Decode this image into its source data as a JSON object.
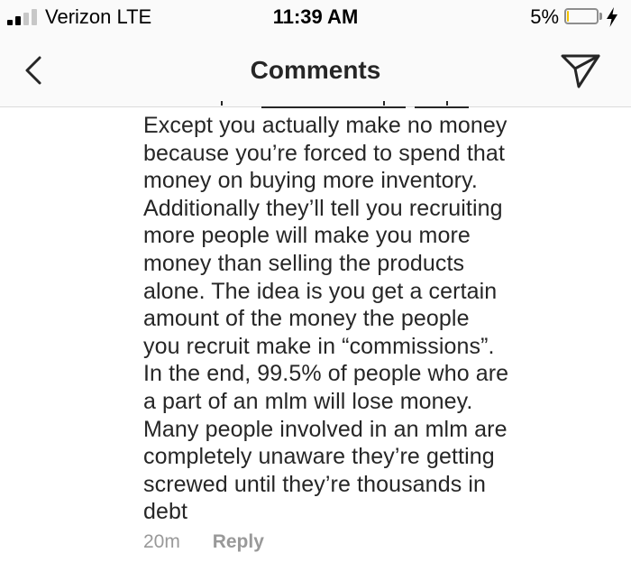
{
  "status_bar": {
    "carrier": "Verizon  LTE",
    "time": "11:39 AM",
    "battery_percent": "5%",
    "battery_level": 0.05,
    "signal_bars_filled": 2,
    "signal_bars_total": 4
  },
  "nav": {
    "title": "Comments",
    "back_icon": "chevron-left-icon",
    "share_icon": "paper-plane-icon"
  },
  "comment": {
    "lines": [
      "Except you actually make no money",
      "because you’re forced to spend that",
      "money on buying more inventory.",
      "Additionally they’ll tell you recruiting",
      "more people will make you more",
      "money than selling the products",
      "alone. The idea is you get a certain",
      "amount of the money the people",
      "you recruit make in “commissions”.",
      "In the end, 99.5% of people who are",
      "a part of an mlm will lose money.",
      "Many people involved in an mlm are",
      "completely unaware they’re getting",
      "screwed until they’re thousands in",
      "debt"
    ],
    "time_ago": "20m",
    "reply_label": "Reply"
  },
  "colors": {
    "header_bg": "#fafafa",
    "text": "#262626",
    "meta": "#999999",
    "battery_low": "#f2c200"
  }
}
